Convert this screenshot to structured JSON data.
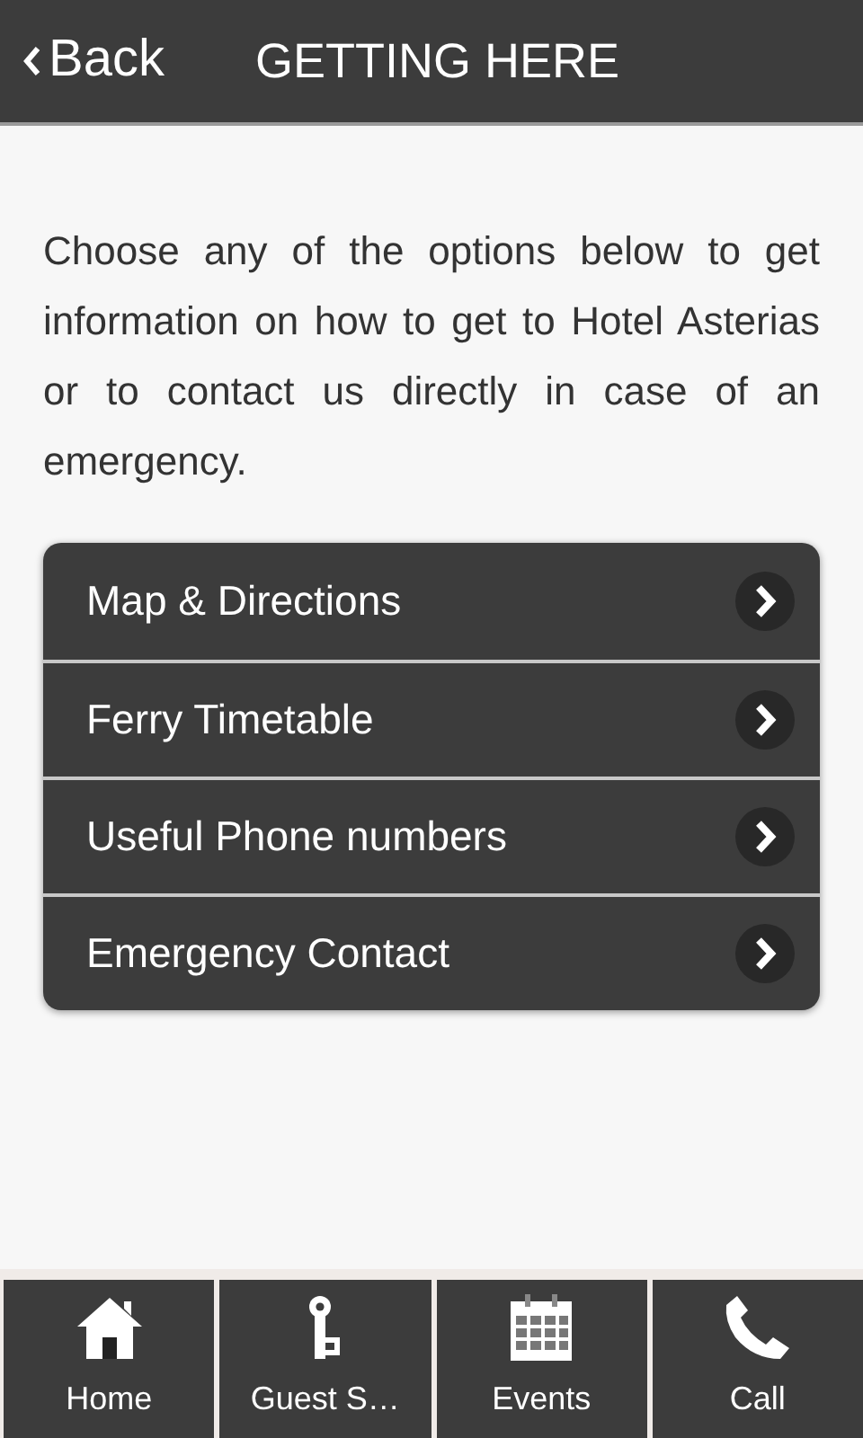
{
  "header": {
    "back": "Back",
    "title": "GETTING HERE"
  },
  "intro": "Choose any of the options below to get information on how to get to Hotel Asterias or to contact us directly in case of an emergency.",
  "options": [
    {
      "label": "Map & Directions"
    },
    {
      "label": "Ferry Timetable"
    },
    {
      "label": "Useful Phone numbers"
    },
    {
      "label": "Emergency Contact"
    }
  ],
  "tab_bar": [
    {
      "kind": "home",
      "label": "Home"
    },
    {
      "kind": "key",
      "label": "Guest S…"
    },
    {
      "kind": "calendar",
      "label": "Events"
    },
    {
      "kind": "phone",
      "label": "Call"
    }
  ]
}
